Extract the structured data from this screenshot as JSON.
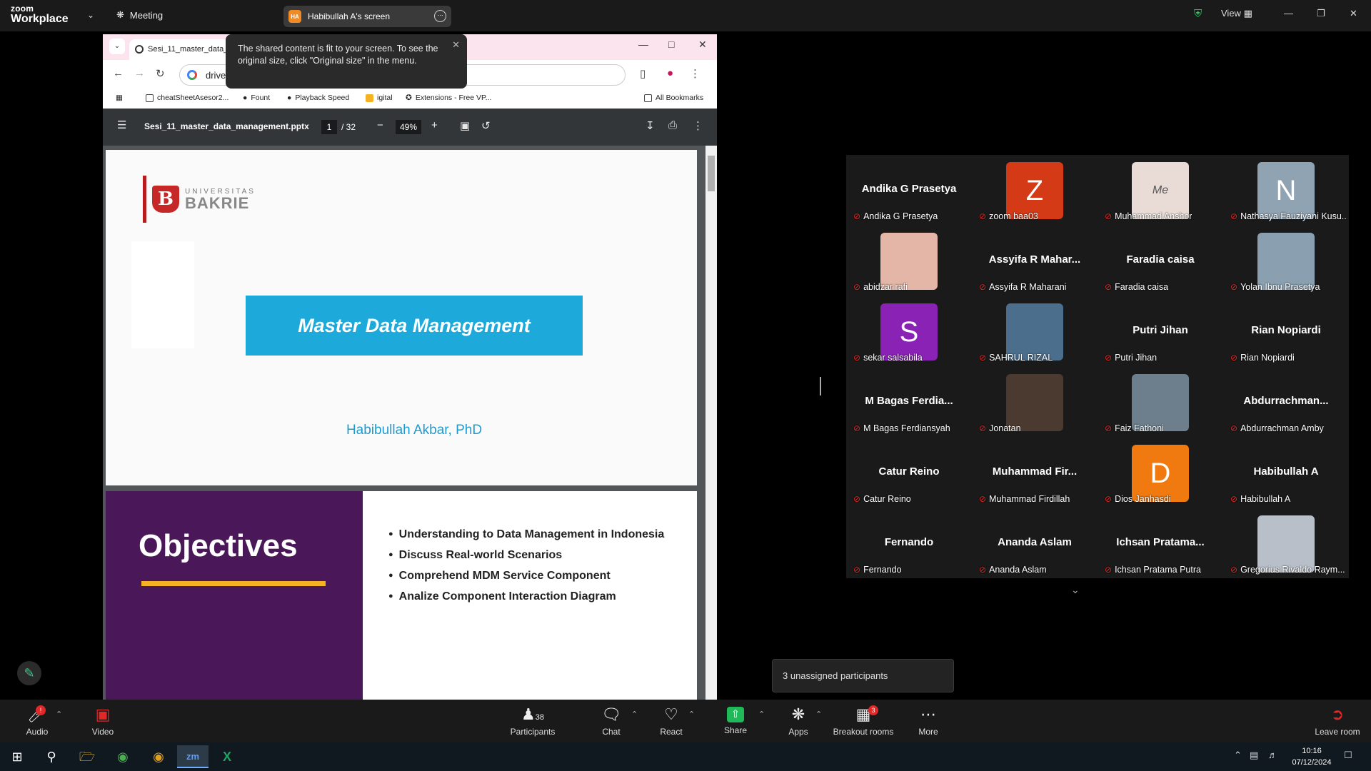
{
  "zoom": {
    "logo_top": "zoom",
    "logo_bottom": "Workplace",
    "meeting_label": "Meeting",
    "share_initials": "HA",
    "share_title": "Habibullah A's screen",
    "view_label": "View"
  },
  "tooltip": {
    "text": "The shared content is fit to your screen. To see the original size, click \"Original size\" in the menu."
  },
  "browser": {
    "tab_title": "Sesi_11_master_data_r",
    "address": "drive",
    "bookmarks": [
      "cheatSheetAsesor2...",
      "Fount",
      "Playback Speed",
      "igital",
      "Extensions - Free VP...",
      "All Bookmarks"
    ]
  },
  "pdf": {
    "filename": "Sesi_11_master_data_management.pptx",
    "page": "1",
    "total": "/ 32",
    "zoom": "49%"
  },
  "slide1": {
    "uni_top": "UNIVERSITAS",
    "uni_name": "BAKRIE",
    "title": "Master Data Management",
    "author": "Habibullah Akbar, PhD"
  },
  "slide2": {
    "heading": "Objectives",
    "items": [
      "Understanding to Data Management in Indonesia",
      "Discuss Real-world Scenarios",
      "Comprehend MDM Service Component",
      "Analize Component Interaction Diagram"
    ]
  },
  "participants": [
    {
      "display": "Andika G Prasetya",
      "label": "Andika G Prasetya",
      "avatar": ""
    },
    {
      "display": "",
      "label": "zoom baa03",
      "avatar": "Z",
      "color": "#d43a16"
    },
    {
      "display": "",
      "label": "Muhammad Anshor",
      "avatar": "Me",
      "color": "#e9dcd6"
    },
    {
      "display": "",
      "label": "Nathasya Fauziyani Kusu...",
      "avatar": "N",
      "color": "#8fa3b3"
    },
    {
      "display": "",
      "label": "abidzar rafi",
      "avatar": "",
      "color": "#e3b6a7"
    },
    {
      "display": "Assyifa R Mahar...",
      "label": "Assyifa R Maharani",
      "avatar": ""
    },
    {
      "display": "Faradia caisa",
      "label": "Faradia caisa",
      "avatar": ""
    },
    {
      "display": "",
      "label": "Yolan Ibnu Prasetya",
      "avatar": "",
      "color": "#8aa0b0"
    },
    {
      "display": "",
      "label": "sekar salsabila",
      "avatar": "S",
      "color": "#8a23b5"
    },
    {
      "display": "",
      "label": "SAHRUL RIZAL",
      "avatar": "",
      "color": "#4a6e8c"
    },
    {
      "display": "Putri Jihan",
      "label": "Putri Jihan",
      "avatar": ""
    },
    {
      "display": "Rian Nopiardi",
      "label": "Rian Nopiardi",
      "avatar": ""
    },
    {
      "display": "M Bagas Ferdia...",
      "label": "M Bagas Ferdiansyah",
      "avatar": ""
    },
    {
      "display": "",
      "label": "Jonatan",
      "avatar": "",
      "color": "#4b3a30"
    },
    {
      "display": "",
      "label": "Faiz Fathoni",
      "avatar": "",
      "color": "#6d7f8c"
    },
    {
      "display": "Abdurrachman...",
      "label": "Abdurrachman Amby",
      "avatar": ""
    },
    {
      "display": "Catur Reino",
      "label": "Catur Reino",
      "avatar": ""
    },
    {
      "display": "Muhammad Fir...",
      "label": "Muhammad Firdillah",
      "avatar": ""
    },
    {
      "display": "",
      "label": "Dios Janhasdi",
      "avatar": "D",
      "color": "#f07a0f"
    },
    {
      "display": "Habibullah A",
      "label": "Habibullah A",
      "avatar": ""
    },
    {
      "display": "Fernando",
      "label": "Fernando",
      "avatar": ""
    },
    {
      "display": "Ananda Aslam",
      "label": "Ananda Aslam",
      "avatar": ""
    },
    {
      "display": "Ichsan Pratama...",
      "label": "Ichsan Pratama Putra",
      "avatar": ""
    },
    {
      "display": "",
      "label": "Gregorius Rivaldo Raym...",
      "avatar": "",
      "color": "#b8bfc8"
    }
  ],
  "unassigned": "3 unassigned participants",
  "toolbar": {
    "audio": "Audio",
    "video": "Video",
    "participants": "Participants",
    "participants_count": "38",
    "chat": "Chat",
    "react": "React",
    "share": "Share",
    "apps": "Apps",
    "breakout": "Breakout rooms",
    "breakout_badge": "3",
    "more": "More",
    "leave": "Leave room",
    "audio_badge": "!"
  },
  "clock": {
    "time": "10:16",
    "date": "07/12/2024"
  }
}
